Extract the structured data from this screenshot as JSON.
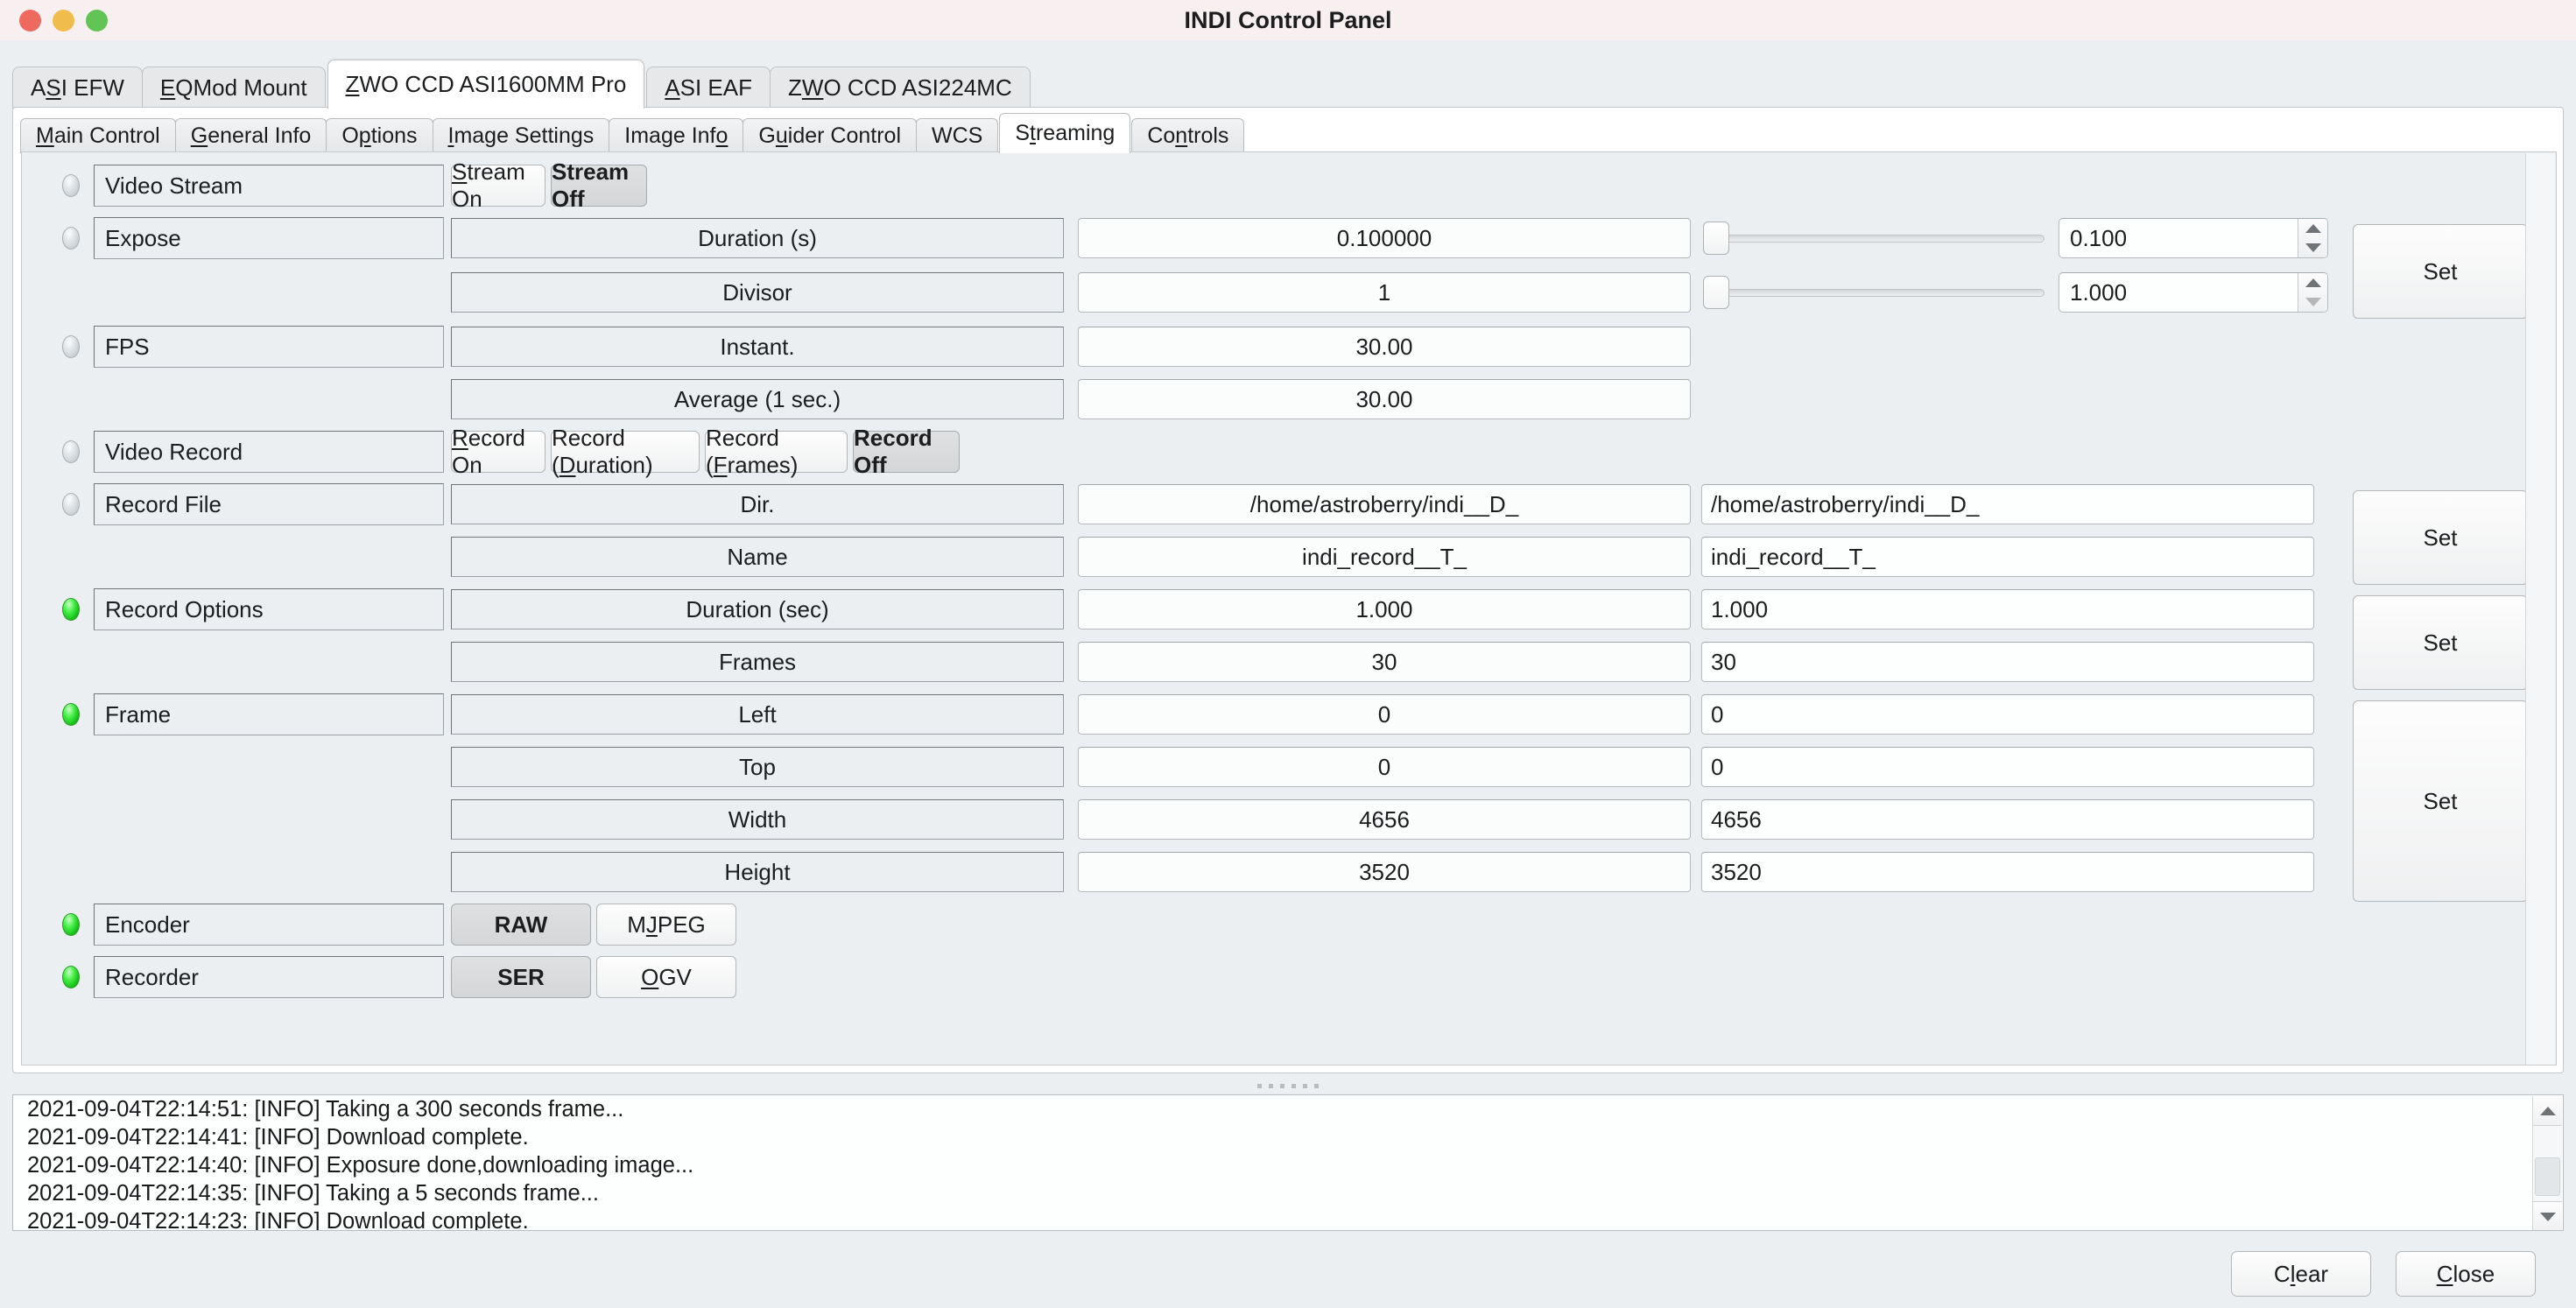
{
  "window": {
    "title": "INDI Control Panel",
    "traffic_lights": [
      "close",
      "minimize",
      "maximize"
    ]
  },
  "device_tabs": [
    {
      "label": "ASI EFW",
      "mnemonic": "S",
      "active": false
    },
    {
      "label": "EQMod Mount",
      "mnemonic": "E",
      "active": false
    },
    {
      "label": "ZWO CCD ASI1600MM Pro",
      "mnemonic": "Z",
      "active": true
    },
    {
      "label": "ASI EAF",
      "mnemonic": "A",
      "active": false
    },
    {
      "label": "ZWO CCD ASI224MC",
      "mnemonic": "W",
      "active": false
    }
  ],
  "sub_tabs": [
    {
      "label": "Main Control",
      "mnemonic": "M",
      "active": false
    },
    {
      "label": "General Info",
      "mnemonic": "G",
      "active": false
    },
    {
      "label": "Options",
      "mnemonic": "p",
      "active": false
    },
    {
      "label": "Image Settings",
      "mnemonic": "I",
      "active": false
    },
    {
      "label": "Image Info",
      "mnemonic": "o",
      "active": false
    },
    {
      "label": "Guider Control",
      "mnemonic": "u",
      "active": false
    },
    {
      "label": "WCS",
      "mnemonic": "",
      "active": false
    },
    {
      "label": "Streaming",
      "mnemonic": "t",
      "active": true
    },
    {
      "label": "Controls",
      "mnemonic": "n",
      "active": false
    }
  ],
  "properties": {
    "video_stream": {
      "led": "idle",
      "name": "Video Stream",
      "buttons": [
        {
          "label": "Stream On",
          "mnemonic": "S",
          "selected": false
        },
        {
          "label": "Stream Off",
          "mnemonic": "",
          "selected": true
        }
      ]
    },
    "expose": {
      "led": "idle",
      "name": "Expose",
      "rows": [
        {
          "label": "Duration (s)",
          "value": "0.100000",
          "edit": "0.100",
          "slider_pos": 0
        },
        {
          "label": "Divisor",
          "value": "1",
          "edit": "1.000",
          "slider_pos": 0
        }
      ],
      "set_label": "Set"
    },
    "fps": {
      "led": "idle",
      "name": "FPS",
      "rows": [
        {
          "label": "Instant.",
          "value": "30.00"
        },
        {
          "label": "Average (1 sec.)",
          "value": "30.00"
        }
      ]
    },
    "video_record": {
      "led": "idle",
      "name": "Video Record",
      "buttons": [
        {
          "label": "Record On",
          "mnemonic": "R",
          "selected": false
        },
        {
          "label": "Record (Duration)",
          "mnemonic": "D",
          "selected": false
        },
        {
          "label": "Record (Frames)",
          "mnemonic": "F",
          "selected": false
        },
        {
          "label": "Record Off",
          "mnemonic": "",
          "selected": true
        }
      ]
    },
    "record_file": {
      "led": "idle",
      "name": "Record File",
      "rows": [
        {
          "label": "Dir.",
          "value": "/home/astroberry/indi__D_",
          "edit": "/home/astroberry/indi__D_"
        },
        {
          "label": "Name",
          "value": "indi_record__T_",
          "edit": "indi_record__T_"
        }
      ],
      "set_label": "Set"
    },
    "record_options": {
      "led": "ok",
      "name": "Record Options",
      "rows": [
        {
          "label": "Duration (sec)",
          "value": "1.000",
          "edit": "1.000"
        },
        {
          "label": "Frames",
          "value": "30",
          "edit": "30"
        }
      ],
      "set_label": "Set"
    },
    "frame": {
      "led": "ok",
      "name": "Frame",
      "rows": [
        {
          "label": "Left",
          "value": "0",
          "edit": "0"
        },
        {
          "label": "Top",
          "value": "0",
          "edit": "0"
        },
        {
          "label": "Width",
          "value": "4656",
          "edit": "4656"
        },
        {
          "label": "Height",
          "value": "3520",
          "edit": "3520"
        }
      ],
      "set_label": "Set"
    },
    "encoder": {
      "led": "ok",
      "name": "Encoder",
      "buttons": [
        {
          "label": "RAW",
          "mnemonic": "",
          "selected": true
        },
        {
          "label": "MJPEG",
          "mnemonic": "J",
          "selected": false
        }
      ]
    },
    "recorder": {
      "led": "ok",
      "name": "Recorder",
      "buttons": [
        {
          "label": "SER",
          "mnemonic": "",
          "selected": true
        },
        {
          "label": "OGV",
          "mnemonic": "O",
          "selected": false
        }
      ]
    }
  },
  "log": {
    "lines": [
      "2021-09-04T22:14:51: [INFO] Taking a 300 seconds frame...",
      "2021-09-04T22:14:41: [INFO] Download complete.",
      "2021-09-04T22:14:40: [INFO] Exposure done,downloading image...",
      "2021-09-04T22:14:35: [INFO] Taking a 5 seconds frame...",
      "2021-09-04T22:14:23: [INFO] Download complete."
    ]
  },
  "footer": {
    "clear_label": "Clear",
    "close_label": "Close"
  },
  "colors": {
    "titlebar": "#f8f0f0",
    "led_ok": "#17c217",
    "led_idle": "#c9ced2",
    "panel_bg": "#eceff1",
    "accent_selected": "#d7d9da"
  }
}
